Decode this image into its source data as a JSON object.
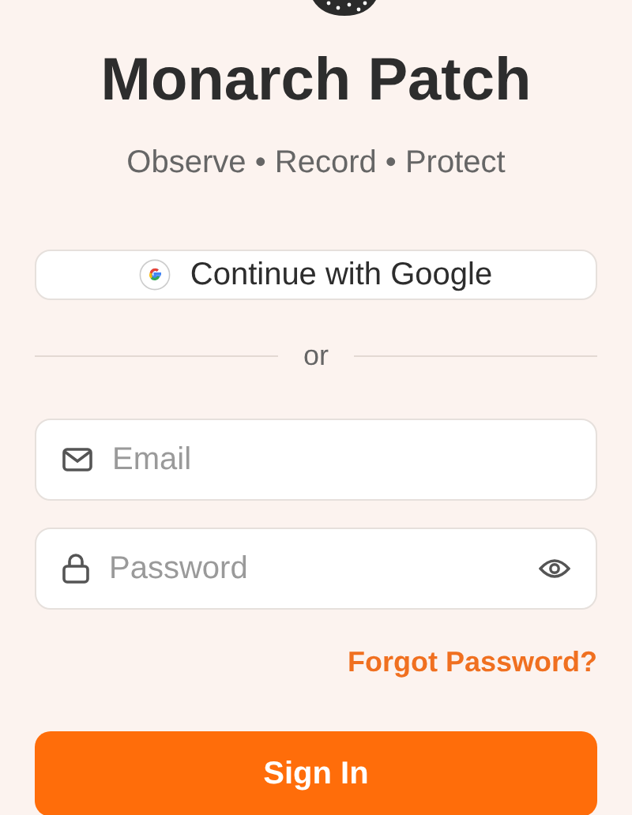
{
  "title": "Monarch Patch",
  "tagline": "Observe • Record • Protect",
  "google_button": {
    "label": "Continue with Google"
  },
  "divider": {
    "label": "or"
  },
  "fields": [
    {
      "kind": "email",
      "placeholder": "Email"
    },
    {
      "kind": "password",
      "placeholder": "Password"
    }
  ],
  "forgot_link": "Forgot Password?",
  "sign_in_button": "Sign In"
}
